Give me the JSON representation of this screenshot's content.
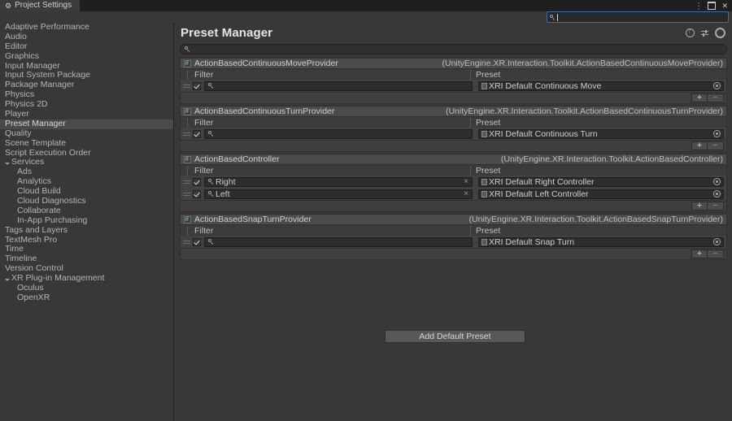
{
  "window": {
    "tab_label": "Project Settings",
    "tab_icon": "gear-icon",
    "controls": {
      "menu": "⋮",
      "maximize": "maximize-icon",
      "close": "✕"
    }
  },
  "top_search": {
    "value": "",
    "placeholder": "",
    "icon": "search-icon"
  },
  "sidebar": {
    "items": [
      {
        "label": "Adaptive Performance",
        "indent": 0,
        "selected": false,
        "foldout": "none"
      },
      {
        "label": "Audio",
        "indent": 0,
        "selected": false,
        "foldout": "none"
      },
      {
        "label": "Editor",
        "indent": 0,
        "selected": false,
        "foldout": "none"
      },
      {
        "label": "Graphics",
        "indent": 0,
        "selected": false,
        "foldout": "none"
      },
      {
        "label": "Input Manager",
        "indent": 0,
        "selected": false,
        "foldout": "none"
      },
      {
        "label": "Input System Package",
        "indent": 0,
        "selected": false,
        "foldout": "none"
      },
      {
        "label": "Package Manager",
        "indent": 0,
        "selected": false,
        "foldout": "none"
      },
      {
        "label": "Physics",
        "indent": 0,
        "selected": false,
        "foldout": "none"
      },
      {
        "label": "Physics 2D",
        "indent": 0,
        "selected": false,
        "foldout": "none"
      },
      {
        "label": "Player",
        "indent": 0,
        "selected": false,
        "foldout": "none"
      },
      {
        "label": "Preset Manager",
        "indent": 0,
        "selected": true,
        "foldout": "none"
      },
      {
        "label": "Quality",
        "indent": 0,
        "selected": false,
        "foldout": "none"
      },
      {
        "label": "Scene Template",
        "indent": 0,
        "selected": false,
        "foldout": "none"
      },
      {
        "label": "Script Execution Order",
        "indent": 0,
        "selected": false,
        "foldout": "none"
      },
      {
        "label": "Services",
        "indent": 0,
        "selected": false,
        "foldout": "open"
      },
      {
        "label": "Ads",
        "indent": 1,
        "selected": false,
        "foldout": "none"
      },
      {
        "label": "Analytics",
        "indent": 1,
        "selected": false,
        "foldout": "none"
      },
      {
        "label": "Cloud Build",
        "indent": 1,
        "selected": false,
        "foldout": "none"
      },
      {
        "label": "Cloud Diagnostics",
        "indent": 1,
        "selected": false,
        "foldout": "none"
      },
      {
        "label": "Collaborate",
        "indent": 1,
        "selected": false,
        "foldout": "none"
      },
      {
        "label": "In-App Purchasing",
        "indent": 1,
        "selected": false,
        "foldout": "none"
      },
      {
        "label": "Tags and Layers",
        "indent": 0,
        "selected": false,
        "foldout": "none"
      },
      {
        "label": "TextMesh Pro",
        "indent": 0,
        "selected": false,
        "foldout": "none"
      },
      {
        "label": "Time",
        "indent": 0,
        "selected": false,
        "foldout": "none"
      },
      {
        "label": "Timeline",
        "indent": 0,
        "selected": false,
        "foldout": "none"
      },
      {
        "label": "Version Control",
        "indent": 0,
        "selected": false,
        "foldout": "none"
      },
      {
        "label": "XR Plug-in Management",
        "indent": 0,
        "selected": false,
        "foldout": "open"
      },
      {
        "label": "Oculus",
        "indent": 1,
        "selected": false,
        "foldout": "none"
      },
      {
        "label": "OpenXR",
        "indent": 1,
        "selected": false,
        "foldout": "none"
      }
    ]
  },
  "main": {
    "title": "Preset Manager",
    "header_icons": [
      {
        "name": "help-icon",
        "glyph": "?"
      },
      {
        "name": "preset-icon",
        "glyph": "sliders"
      },
      {
        "name": "gear-icon",
        "glyph": "gear"
      }
    ],
    "search": {
      "value": "",
      "placeholder": "",
      "icon": "search-icon"
    },
    "columns": {
      "filter": "Filter",
      "preset": "Preset"
    },
    "add_default_preset_label": "Add Default Preset",
    "groups": [
      {
        "name": "ActionBasedContinuousMoveProvider",
        "type": "(UnityEngine.XR.Interaction.Toolkit.ActionBasedContinuousMoveProvider)",
        "rows": [
          {
            "enabled": true,
            "filter": "",
            "has_clear": false,
            "preset": "XRI Default Continuous Move"
          }
        ],
        "add_label": "+",
        "remove_label": "−"
      },
      {
        "name": "ActionBasedContinuousTurnProvider",
        "type": "(UnityEngine.XR.Interaction.Toolkit.ActionBasedContinuousTurnProvider)",
        "rows": [
          {
            "enabled": true,
            "filter": "",
            "has_clear": false,
            "preset": "XRI Default Continuous Turn"
          }
        ],
        "add_label": "+",
        "remove_label": "−"
      },
      {
        "name": "ActionBasedController",
        "type": "(UnityEngine.XR.Interaction.Toolkit.ActionBasedController)",
        "rows": [
          {
            "enabled": true,
            "filter": "Right",
            "has_clear": true,
            "preset": "XRI Default Right Controller"
          },
          {
            "enabled": true,
            "filter": "Left",
            "has_clear": true,
            "preset": "XRI Default Left Controller"
          }
        ],
        "add_label": "+",
        "remove_label": "−"
      },
      {
        "name": "ActionBasedSnapTurnProvider",
        "type": "(UnityEngine.XR.Interaction.Toolkit.ActionBasedSnapTurnProvider)",
        "rows": [
          {
            "enabled": true,
            "filter": "",
            "has_clear": false,
            "preset": "XRI Default Snap Turn"
          }
        ],
        "add_label": "+",
        "remove_label": "−"
      }
    ]
  },
  "colors": {
    "window_bg": "#383838",
    "titlebar_bg": "#1f1f1f",
    "selection": "#4a4a4a",
    "group_head": "#4b4b4b",
    "field_bg": "#2d2d2d",
    "focus_border": "#3d6ea5",
    "text": "#c4c4c4"
  }
}
